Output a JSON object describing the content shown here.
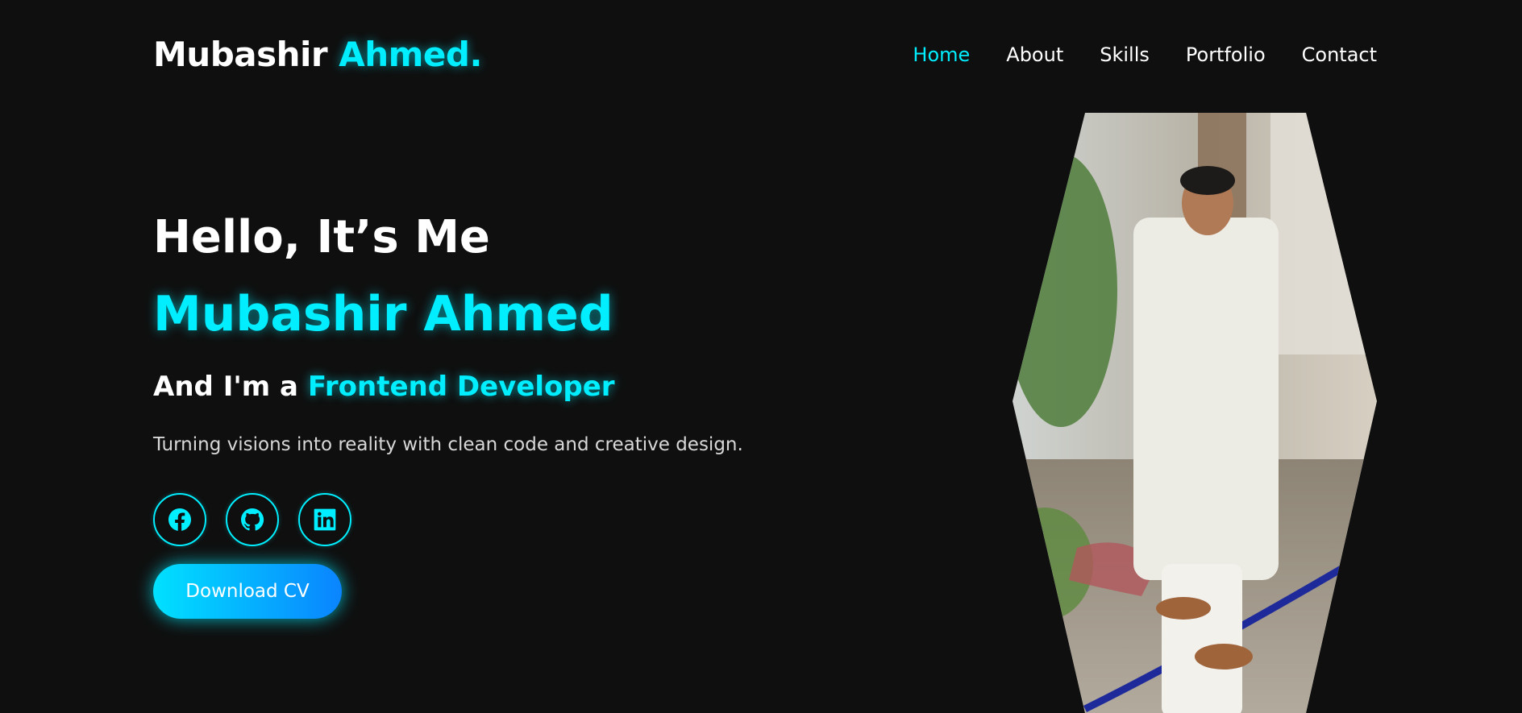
{
  "logo": {
    "first": "Mubashir",
    "accent": "Ahmed."
  },
  "nav": {
    "items": [
      {
        "label": "Home",
        "active": true
      },
      {
        "label": "About",
        "active": false
      },
      {
        "label": "Skills",
        "active": false
      },
      {
        "label": "Portfolio",
        "active": false
      },
      {
        "label": "Contact",
        "active": false
      }
    ]
  },
  "hero": {
    "greeting": "Hello, It’s Me",
    "name": "Mubashir Ahmed",
    "role_prefix": "And I'm a",
    "role": "Frontend Developer",
    "tagline": "Turning visions into reality with clean code and creative design."
  },
  "socials": [
    {
      "icon": "facebook-icon"
    },
    {
      "icon": "github-icon"
    },
    {
      "icon": "linkedin-icon"
    }
  ],
  "cv_button": {
    "label": "Download CV"
  },
  "colors": {
    "accent": "#00eeff",
    "background": "#0f0f0f",
    "text": "#ffffff"
  }
}
